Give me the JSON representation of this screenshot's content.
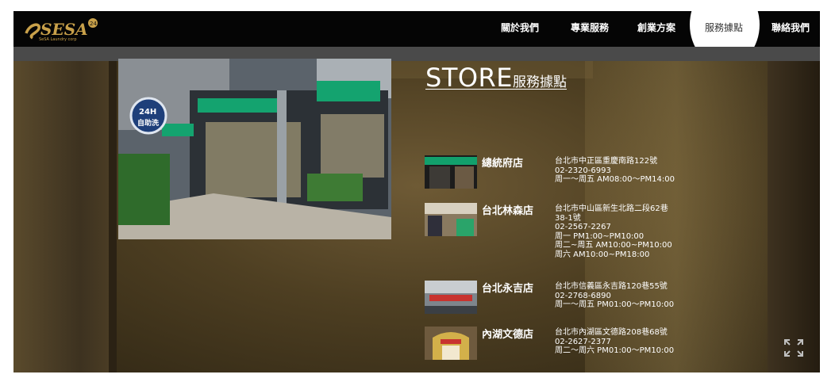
{
  "brand": {
    "logo_text": "SESA",
    "logo_tagline": "SeSA Laundry corp",
    "logo_badge": "24"
  },
  "nav": {
    "items": [
      {
        "label": "關於我們"
      },
      {
        "label": "專業服務"
      },
      {
        "label": "創業方案"
      },
      {
        "label": "服務據點",
        "active": true
      },
      {
        "label": "聯絡我們"
      }
    ]
  },
  "page": {
    "title_main": "STORE",
    "title_sub": "服務據點"
  },
  "stores": [
    {
      "name": "總統府店",
      "lines": [
        "台北市中正區重慶南路122號",
        "02-2320-6993",
        "周一～周五 AM08:00～PM14:00"
      ]
    },
    {
      "name": "台北林森店",
      "lines": [
        "台北市中山區新生北路二段62巷",
        "38-1號",
        "02-2567-2267",
        "周一 PM1:00~PM10:00",
        "周二~周五 AM10:00~PM10:00",
        "周六 AM10:00~PM18:00"
      ]
    },
    {
      "name": "台北永吉店",
      "lines": [
        "台北市信義區永吉路120巷55號",
        "02-2768-6890",
        "周一～周五 PM01:00～PM10:00"
      ]
    },
    {
      "name": "內湖文德店",
      "lines": [
        "台北市內湖區文德路208巷68號",
        "02-2627-2377",
        "周二～周六 PM01:00～PM10:00"
      ]
    }
  ],
  "photo": {
    "badge_top": "24H",
    "badge_bottom": "自助洗"
  },
  "colors": {
    "topbar": "#050505",
    "subbar": "#4a4a4a",
    "accent_green": "#1a9e6a",
    "text": "#ffffff"
  }
}
